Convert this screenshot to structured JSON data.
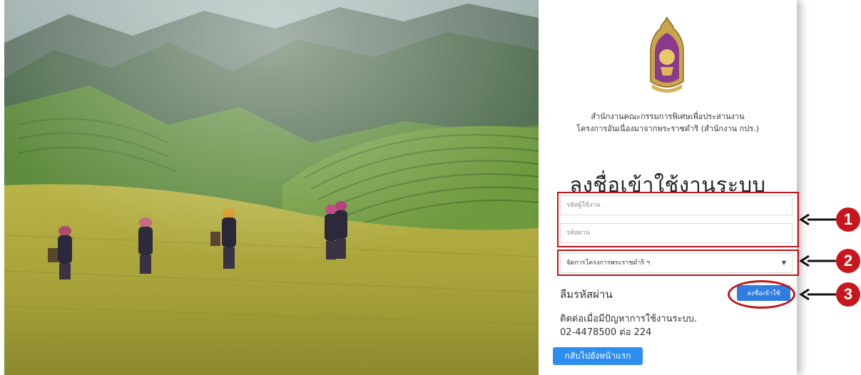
{
  "hero": {
    "scene": "rice-terraces-photo"
  },
  "panel": {
    "org_line_1": "สำนักงานคณะกรรมการพิเศษเพื่อประสานงาน",
    "org_line_2": "โครงการอันเนื่องมาจากพระราชดำริ (สำนักงาน กปร.)",
    "heading": "ลงชื่อเข้าใช้งานระบบ",
    "username_placeholder": "รหัสผู้ใช้งาน",
    "password_placeholder": "รหัสผ่าน",
    "system_select_value": "จัดการโครงการพระราชดำริ ฯ",
    "forgot_password": "ลืมรหัสผ่าน",
    "login_button": "ลงชื่อเข้าใช้",
    "help_text": "ติดต่อเมื่อมีปัญหาการใช้งานระบบ.",
    "help_phone": "02-4478500 ต่อ 224",
    "home_button": "กลับไปยังหน้าแรก"
  },
  "annotations": {
    "step_1": "1",
    "step_2": "2",
    "step_3": "3",
    "color": "#c8161d"
  },
  "colors": {
    "login_button": "#2f7de1",
    "home_button": "#2d8ef0"
  }
}
